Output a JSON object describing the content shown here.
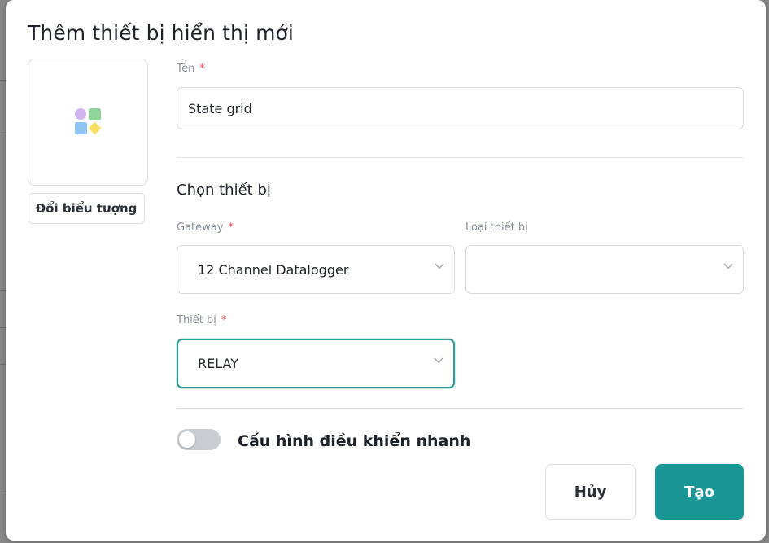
{
  "dialog": {
    "title": "Thêm thiết bị hiển thị mới",
    "change_icon_label": "Đổi biểu tượng",
    "name_field": {
      "label": "Tên",
      "required_mark": "*",
      "value": "State grid"
    },
    "section_title": "Chọn thiết bị",
    "gateway": {
      "label": "Gateway",
      "required_mark": "*",
      "value": "12 Channel Datalogger",
      "icon": "chevron-down-icon"
    },
    "device_type": {
      "label": "Loại thiết bị",
      "value": "",
      "icon": "chevron-down-icon"
    },
    "device": {
      "label": "Thiết bị",
      "required_mark": "*",
      "value": "RELAY",
      "icon": "chevron-down-icon"
    },
    "quick_control": {
      "label": "Cấu hình điều khiển nhanh",
      "enabled": false
    },
    "buttons": {
      "cancel": "Hủy",
      "create": "Tạo"
    }
  },
  "colors": {
    "accent": "#1a9696",
    "focus_border": "#2e9c9a",
    "required": "#e5484d",
    "toggle_off": "#c9ccd1"
  }
}
